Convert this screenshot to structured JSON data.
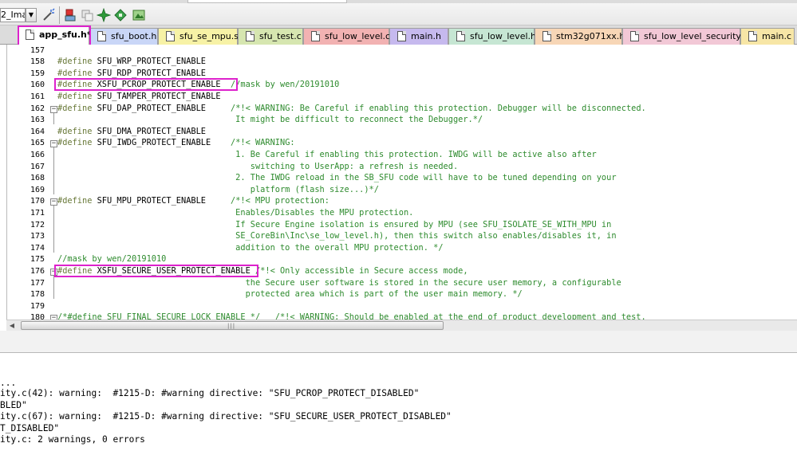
{
  "toolbar": {
    "target_value": "2_Imaç",
    "buttons": [
      {
        "name": "wand-icon"
      },
      {
        "name": "load-icon"
      },
      {
        "name": "copy-icon"
      },
      {
        "name": "manage-icon"
      },
      {
        "name": "components-icon"
      },
      {
        "name": "pack-installer-icon"
      }
    ]
  },
  "tabs": [
    {
      "label": "app_sfu.h*",
      "color": "#ffffff",
      "active": true
    },
    {
      "label": "sfu_boot.h",
      "color": "#c9d6f7"
    },
    {
      "label": "sfu_se_mpu.s",
      "color": "#f7f2a6"
    },
    {
      "label": "sfu_test.c",
      "color": "#d6e6b0"
    },
    {
      "label": "sfu_low_level.c",
      "color": "#f2b2b2"
    },
    {
      "label": "main.h",
      "color": "#c6b9ee"
    },
    {
      "label": "sfu_low_level.h",
      "color": "#c6e6d3"
    },
    {
      "label": "stm32g071xx.h",
      "color": "#f7d6b6"
    },
    {
      "label": "sfu_low_level_security.c",
      "color": "#f2c8d6"
    },
    {
      "label": "main.c",
      "color": "#f7e6a6"
    }
  ],
  "editor": {
    "lines": [
      {
        "num": "157",
        "kw": "",
        "rest": "",
        "cm": ""
      },
      {
        "num": "158",
        "kw": "#define",
        "rest": " SFU_WRP_PROTECT_ENABLE",
        "cm": ""
      },
      {
        "num": "159",
        "kw": "#define",
        "rest": " SFU_RDP_PROTECT_ENABLE",
        "cm": ""
      },
      {
        "num": "160",
        "kw": "#define",
        "rest": " XSFU_PCROP_PROTECT_ENABLE  ",
        "cm": "//mask by wen/20191010"
      },
      {
        "num": "161",
        "kw": "#define",
        "rest": " SFU_TAMPER_PROTECT_ENABLE",
        "cm": ""
      },
      {
        "num": "162",
        "kw": "#define",
        "rest": " SFU_DAP_PROTECT_ENABLE     ",
        "cm": "/*!< WARNING: Be Careful if enabling this protection. Debugger will be disconnected."
      },
      {
        "num": "163",
        "kw": "",
        "rest": "",
        "cm": "                                    It might be difficult to reconnect the Debugger.*/"
      },
      {
        "num": "164",
        "kw": "#define",
        "rest": " SFU_DMA_PROTECT_ENABLE",
        "cm": ""
      },
      {
        "num": "165",
        "kw": "#define",
        "rest": " SFU_IWDG_PROTECT_ENABLE    ",
        "cm": "/*!< WARNING:"
      },
      {
        "num": "166",
        "kw": "",
        "rest": "",
        "cm": "                                    1. Be Careful if enabling this protection. IWDG will be active also after"
      },
      {
        "num": "167",
        "kw": "",
        "rest": "",
        "cm": "                                       switching to UserApp: a refresh is needed."
      },
      {
        "num": "168",
        "kw": "",
        "rest": "",
        "cm": "                                    2. The IWDG reload in the SB_SFU code will have to be tuned depending on your"
      },
      {
        "num": "169",
        "kw": "",
        "rest": "",
        "cm": "                                       platform (flash size...)*/"
      },
      {
        "num": "170",
        "kw": "#define",
        "rest": " SFU_MPU_PROTECT_ENABLE     ",
        "cm": "/*!< MPU protection:"
      },
      {
        "num": "171",
        "kw": "",
        "rest": "",
        "cm": "                                    Enables/Disables the MPU protection."
      },
      {
        "num": "172",
        "kw": "",
        "rest": "",
        "cm": "                                    If Secure Engine isolation is ensured by MPU (see SFU_ISOLATE_SE_WITH_MPU in"
      },
      {
        "num": "173",
        "kw": "",
        "rest": "",
        "cm": "                                    SE_CoreBin\\Inc\\se_low_level.h), then this switch also enables/disables it, in"
      },
      {
        "num": "174",
        "kw": "",
        "rest": "",
        "cm": "                                    addition to the overall MPU protection. */"
      },
      {
        "num": "175",
        "kw": "",
        "rest": "",
        "cm": "//mask by wen/20191010"
      },
      {
        "num": "176",
        "kw": "#define",
        "rest": " XSFU_SECURE_USER_PROTECT_ENABLE ",
        "cm": "/*!< Only accessible in Secure access mode,"
      },
      {
        "num": "177",
        "kw": "",
        "rest": "",
        "cm": "                                      the Secure user software is stored in the secure user memory, a configurable"
      },
      {
        "num": "178",
        "kw": "",
        "rest": "",
        "cm": "                                      protected area which is part of the user main memory. */"
      },
      {
        "num": "179",
        "kw": "",
        "rest": "",
        "cm": ""
      },
      {
        "num": "180",
        "kw": "",
        "rest": "",
        "cm": "/*#define SFU_FINAL_SECURE_LOCK_ENABLE */   /*!< WARNING: Should be enabled at the end of product development and test."
      }
    ]
  },
  "output": {
    "lines": [
      "...",
      "ity.c(42): warning:  #1215-D: #warning directive: \"SFU_PCROP_PROTECT_DISABLED\"",
      "BLED\"",
      "ity.c(67): warning:  #1215-D: #warning directive: \"SFU_SECURE_USER_PROTECT_DISABLED\"",
      "T_DISABLED\"",
      "ity.c: 2 warnings, 0 errors"
    ]
  },
  "colors": {
    "highlight": "#dd22cc",
    "keyword": "#6a7a3a",
    "comment": "#2e8b2e"
  }
}
